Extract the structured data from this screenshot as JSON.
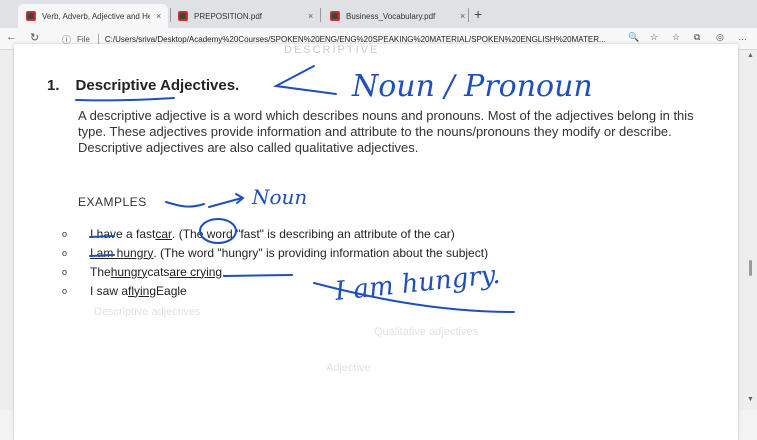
{
  "tabs": [
    {
      "title": "Verb, Adverb, Adjective and Help",
      "close": "×",
      "active": true
    },
    {
      "title": "PREPOSITION.pdf",
      "close": "×",
      "active": false
    },
    {
      "title": "Business_Vocabulary.pdf",
      "close": "×",
      "active": false
    }
  ],
  "new_tab": "+",
  "nav": {
    "back": "←",
    "reload": "↻"
  },
  "address": {
    "info_icon": "ⓘ",
    "scheme_label": "File",
    "url": "C:/Users/sriva/Desktop/Academy%20Courses/SPOKEN%20ENG/ENG%20SPEAKING%20MATERIAL/SPOKEN%20ENGLISH%20MATER..."
  },
  "toolbar_icons": [
    "🔍",
    "☆",
    "☆",
    "⧉",
    "◎",
    "…"
  ],
  "document": {
    "faded_top": "DESCRIPTIVE",
    "heading": {
      "number": "1.",
      "text": "Descriptive Adjectives."
    },
    "paragraph": "A descriptive adjective is a word which describes nouns and pronouns. Most of the adjectives belong in this type. These adjectives provide information and attribute to the nouns/pronouns they modify or describe. Descriptive adjectives are also called qualitative adjectives.",
    "examples_label": "EXAMPLES",
    "bullet_marker": "o",
    "bullets": [
      {
        "pre": "I have a fast ",
        "u": "car",
        "post": ". (The word \"fast\" is describing an attribute of the car)"
      },
      {
        "pre": "",
        "u": "I am hungry",
        "post": ". (The word \"hungry\" is providing information about the subject)"
      },
      {
        "pre": "The ",
        "u": "hungry",
        "mid": " cats ",
        "u2": "are crying",
        "post": "."
      },
      {
        "pre": "I saw a ",
        "u": "flying",
        "post": " Eagle"
      }
    ],
    "faded_lower": [
      "Descriptive adjectives",
      "Qualitative adjectives",
      "Adjective"
    ]
  },
  "annotations": {
    "noun_pronoun": "Noun / Pronoun",
    "noun": "Noun",
    "i_am_hungry": "I am hungry."
  },
  "colors": {
    "ink": "#1f4fb8"
  }
}
